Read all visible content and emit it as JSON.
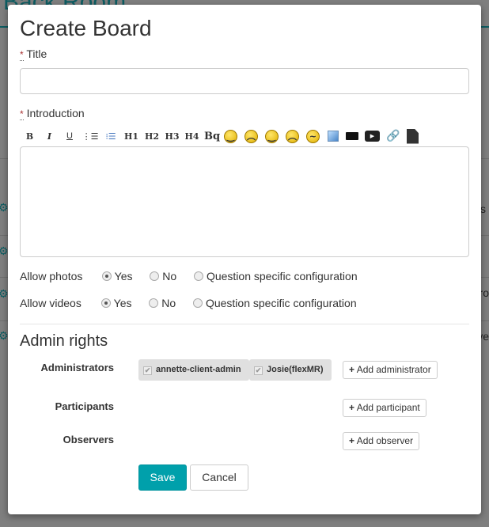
{
  "background": {
    "title": "Back Room",
    "edge_texts": [
      "s",
      "ro",
      "ve"
    ]
  },
  "modal": {
    "title": "Create Board",
    "required_marker": "*",
    "title_label": "Title",
    "title_value": "",
    "intro_label": "Introduction",
    "toolbar": [
      "B",
      "I",
      "U",
      "ordered-list",
      "unordered-list",
      "H1",
      "H2",
      "H3",
      "H4",
      "Bq",
      "smile",
      "sad",
      "wink",
      "angry",
      "confused",
      "image",
      "video",
      "youtube",
      "link",
      "file"
    ],
    "toolbar_text": {
      "bold": "B",
      "italic": "I",
      "underline": "U",
      "h1": "H1",
      "h2": "H2",
      "h3": "H3",
      "h4": "H4",
      "bq": "Bq"
    },
    "allow_photos": {
      "label": "Allow photos",
      "options": [
        "Yes",
        "No",
        "Question specific configuration"
      ],
      "selected": "Yes"
    },
    "allow_videos": {
      "label": "Allow videos",
      "options": [
        "Yes",
        "No",
        "Question specific configuration"
      ],
      "selected": "Yes"
    },
    "admin_rights": {
      "heading": "Admin rights",
      "administrators_label": "Administrators",
      "administrators": [
        "annette-client-admin",
        "Josie(flexMR)"
      ],
      "add_administrator": "Add administrator",
      "participants_label": "Participants",
      "add_participant": "Add participant",
      "observers_label": "Observers",
      "add_observer": "Add observer"
    },
    "save": "Save",
    "cancel": "Cancel",
    "colors": {
      "primary": "#00a0ab",
      "background_accent": "#0d5d62"
    }
  }
}
